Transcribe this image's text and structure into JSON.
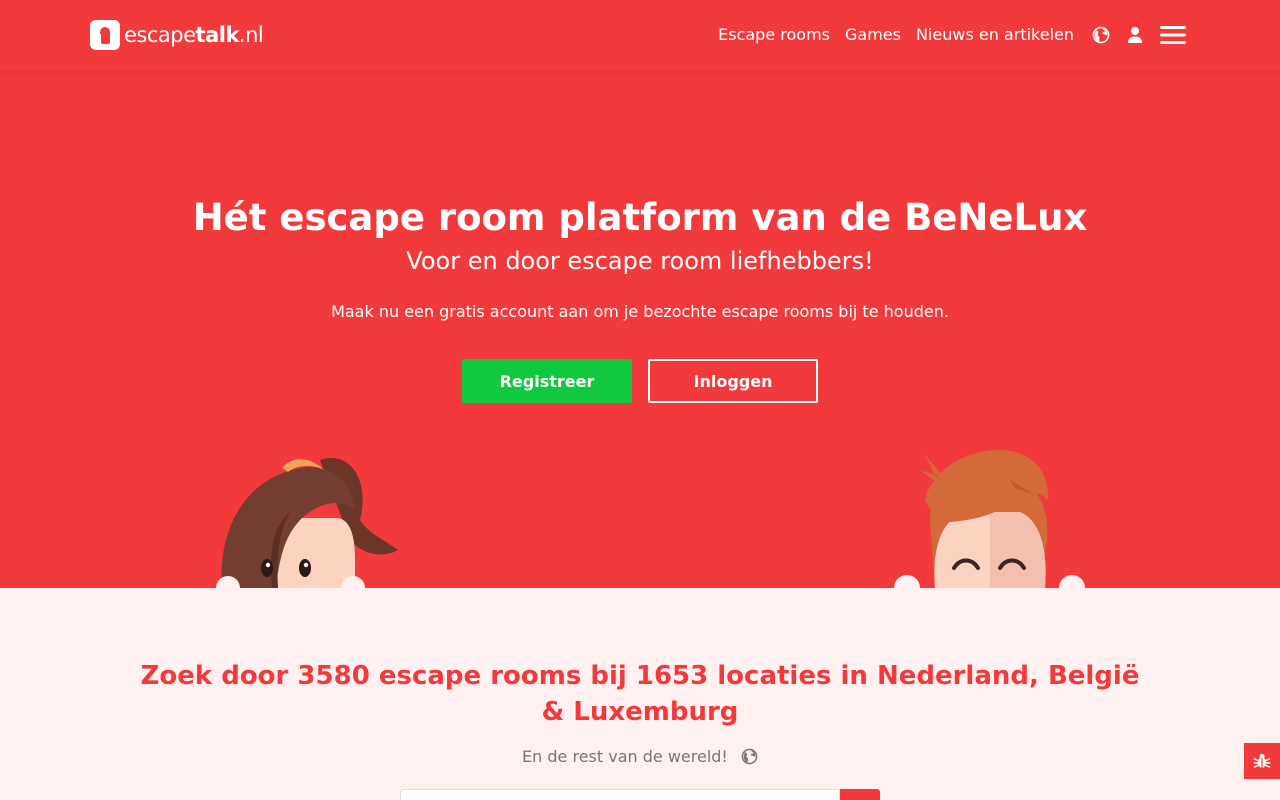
{
  "header": {
    "logo": {
      "text_light": "escape",
      "text_bold": "talk",
      "text_suffix": ".nl"
    },
    "nav": [
      "Escape rooms",
      "Games",
      "Nieuws en artikelen"
    ],
    "icons": [
      "globe-icon",
      "user-icon",
      "hamburger-menu-icon"
    ]
  },
  "hero": {
    "title": "Hét escape room platform van de BeNeLux",
    "subtitle": "Voor en door escape room liefhebbers!",
    "text": "Maak nu een gratis account aan om je bezochte escape rooms bij te houden.",
    "register_label": "Registreer",
    "login_label": "Inloggen"
  },
  "search": {
    "title": "Zoek door 3580 escape rooms bij 1653 locaties in Nederland, België & Luxemburg",
    "sub": "En de rest van de wereld!",
    "placeholder": ""
  },
  "feedback": {
    "icon": "bug-icon"
  },
  "colors": {
    "brand_red": "#f2393b",
    "register_green": "#11c93e",
    "section_bg": "#fff1f0"
  }
}
